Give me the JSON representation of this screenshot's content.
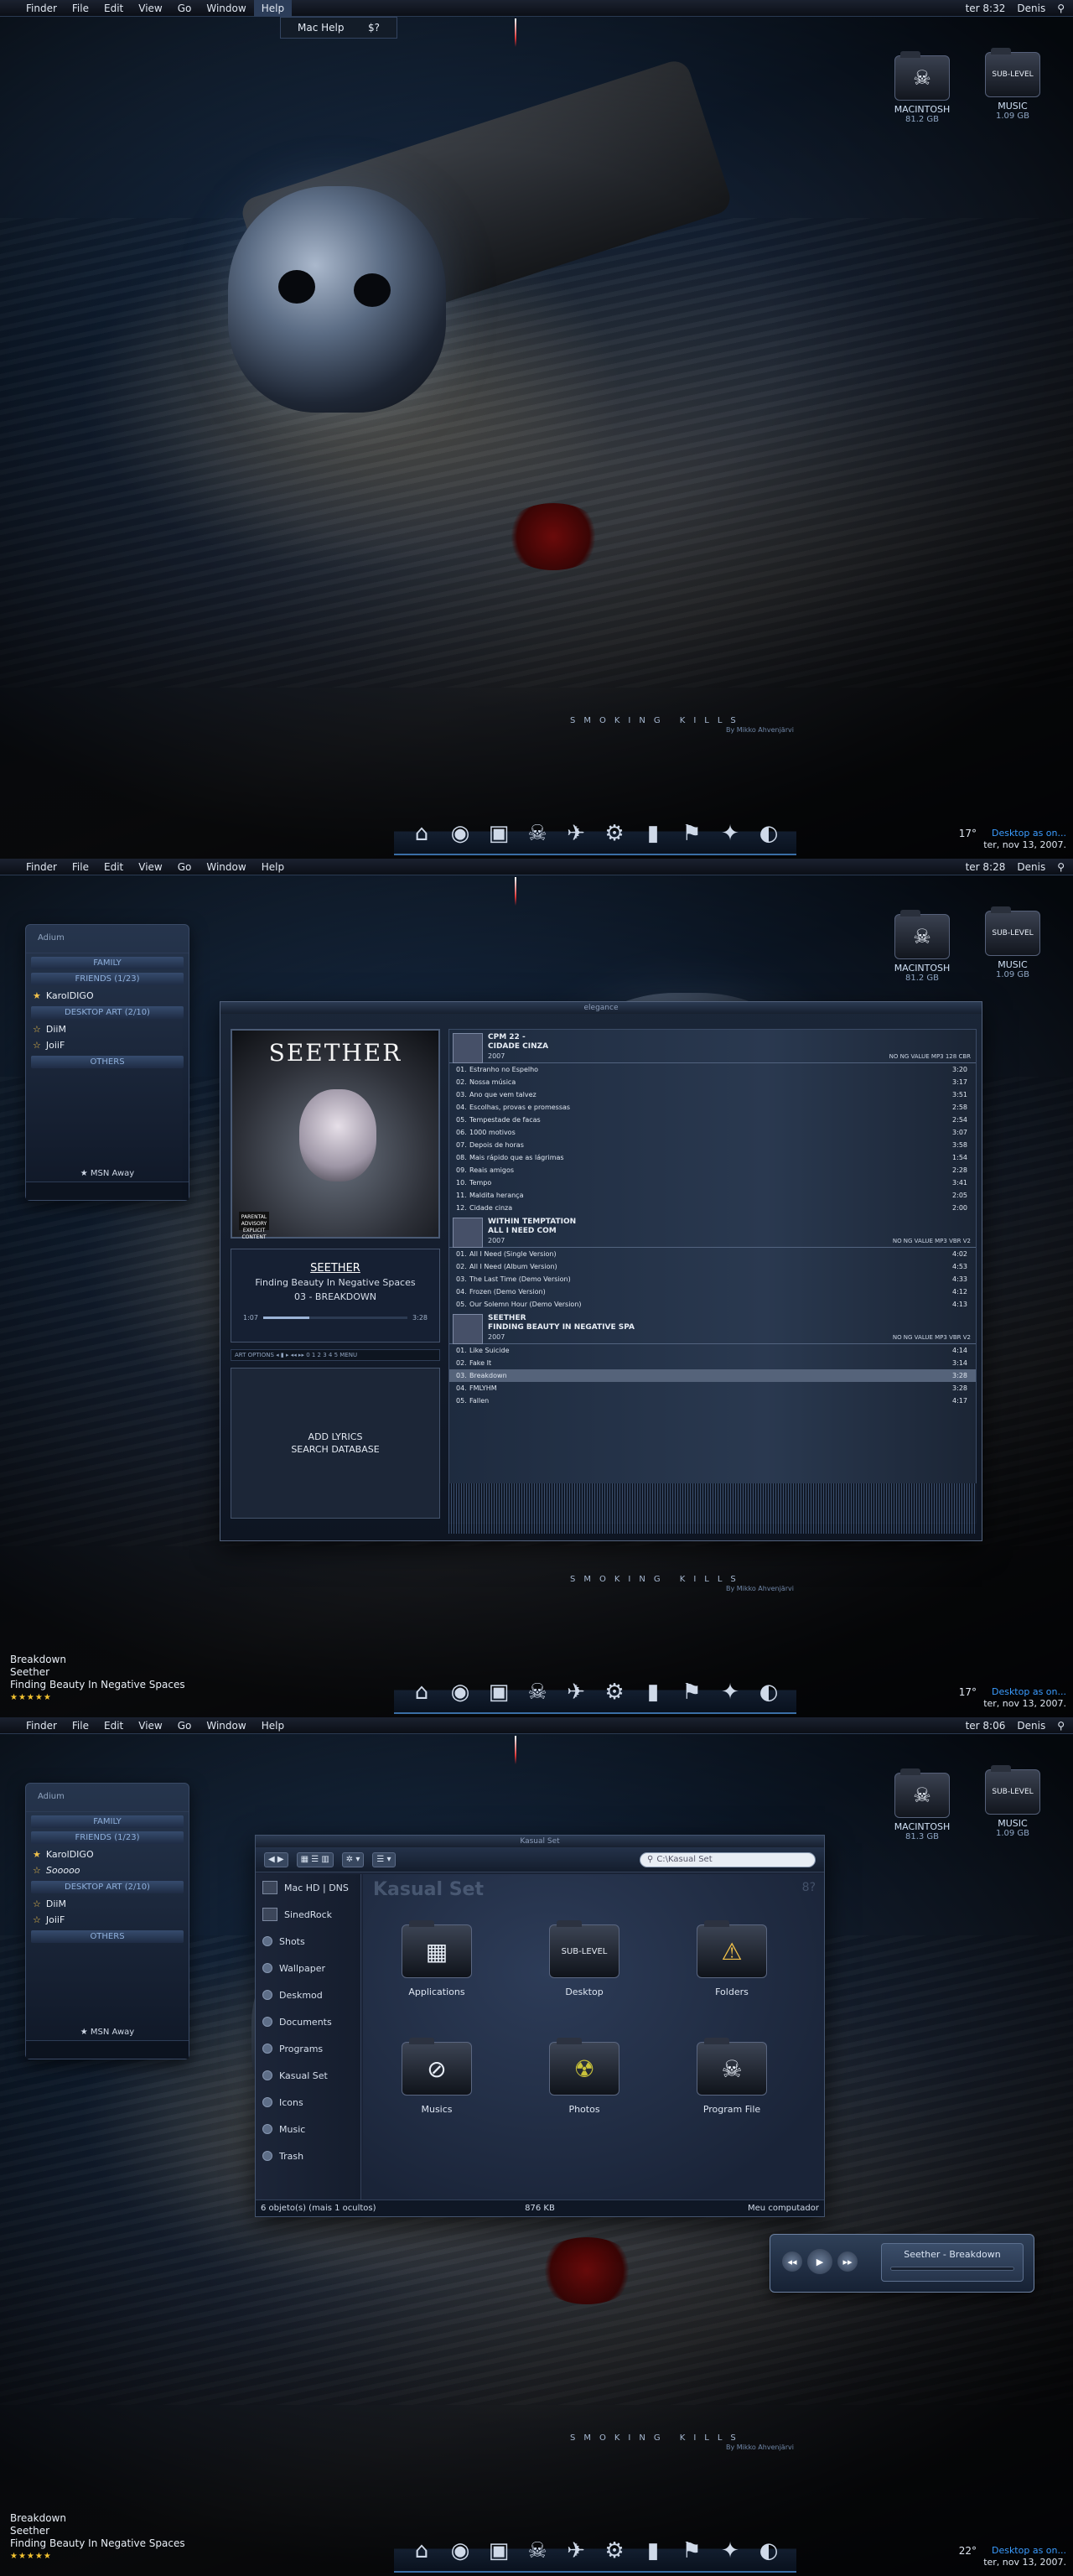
{
  "menubar": {
    "apple": "",
    "items": [
      "Finder",
      "File",
      "Edit",
      "View",
      "Go",
      "Window",
      "Help"
    ],
    "user": "Denis",
    "times": [
      "ter 8:32",
      "ter 8:28",
      "ter 8:06"
    ]
  },
  "help_menu": {
    "label": "Mac Help",
    "shortcut": "$?"
  },
  "drives": [
    {
      "icon": "☠",
      "name": "MACINTOSH",
      "sizes": [
        "81.2 GB",
        "81.2 GB",
        "81.3 GB"
      ]
    },
    {
      "icon": "SUB-LEVEL",
      "name": "MUSIC",
      "sizes": [
        "1.09 GB",
        "1.09 GB",
        "1.09 GB"
      ]
    }
  ],
  "wallpaper": {
    "caption": "SMOKING KILLS",
    "credit": "By Mikko Ahvenjärvi"
  },
  "dock": {
    "icons": [
      "⌂",
      "◉",
      "▣",
      "☠",
      "✈",
      "⚙",
      "▮",
      "⚑",
      "✦",
      "◐"
    ]
  },
  "clock": {
    "temps": [
      "17°",
      "17°",
      "22°"
    ],
    "link": "Desktop as on...",
    "date": "ter, nov 13, 2007."
  },
  "now_playing": {
    "track": "Breakdown",
    "artist": "Seether",
    "album": "Finding Beauty In Negative Spaces",
    "stars": "★★★★★",
    "rating": 5
  },
  "buddy": {
    "title": "Adium",
    "groups": [
      {
        "label": "FAMILY",
        "rows": []
      },
      {
        "label": "FRIENDS (1/23)",
        "rows": [
          {
            "name": "KarolDIGO",
            "star": "★"
          },
          {
            "name": "Sooooo",
            "star": ""
          }
        ]
      },
      {
        "label": "DESKTOP ART (2/10)",
        "rows": [
          {
            "name": "DiiM",
            "star": "☆"
          },
          {
            "name": "JoiiF",
            "star": "☆"
          }
        ]
      },
      {
        "label": "OTHERS",
        "rows": []
      }
    ],
    "status": "★ MSN Away"
  },
  "player": {
    "title": "elegance",
    "art": {
      "band": "SEETHER",
      "advisory": "PARENTAL ADVISORY EXPLICIT CONTENT"
    },
    "info": {
      "band": "SEETHER",
      "album": "Finding Beauty In Negative Spaces",
      "track": "03 - BREAKDOWN",
      "elapsed": "1:07",
      "total": "3:28",
      "progress": 0.32
    },
    "controls": "ART  OPTIONS   ◂ ▮ ▸ ◂◂ ▸▸   0 1 2 3 4 5   MENU",
    "lyrics": [
      "ADD LYRICS",
      "SEARCH DATABASE"
    ],
    "albums": [
      {
        "title": "CPM 22 -",
        "subtitle": "CIDADE CINZA",
        "year": "2007",
        "info": "NO NG VALUE  MP3 128 CBR",
        "tracks": [
          [
            "01.",
            "Estranho no Espelho",
            "3:20"
          ],
          [
            "02.",
            "Nossa música",
            "3:17"
          ],
          [
            "03.",
            "Ano que vem talvez",
            "3:51"
          ],
          [
            "04.",
            "Escolhas, provas e promessas",
            "2:58"
          ],
          [
            "05.",
            "Tempestade de facas",
            "2:54"
          ],
          [
            "06.",
            "1000 motivos",
            "3:07"
          ],
          [
            "07.",
            "Depois de horas",
            "3:58"
          ],
          [
            "08.",
            "Mais rápido que as lágrimas",
            "1:54"
          ],
          [
            "09.",
            "Reais amigos",
            "2:28"
          ],
          [
            "10.",
            "Tempo",
            "3:41"
          ],
          [
            "11.",
            "Maldita herança",
            "2:05"
          ],
          [
            "12.",
            "Cidade cinza",
            "2:00"
          ]
        ]
      },
      {
        "title": "WITHIN TEMPTATION",
        "subtitle": "ALL I NEED COM",
        "year": "2007",
        "info": "NO NG VALUE  MP3 VBR V2",
        "tracks": [
          [
            "01.",
            "All I Need (Single Version)",
            "4:02"
          ],
          [
            "02.",
            "All I Need (Album Version)",
            "4:53"
          ],
          [
            "03.",
            "The Last Time (Demo Version)",
            "4:33"
          ],
          [
            "04.",
            "Frozen (Demo Version)",
            "4:12"
          ],
          [
            "05.",
            "Our Solemn Hour (Demo Version)",
            "4:13"
          ]
        ]
      },
      {
        "title": "SEETHER",
        "subtitle": "FINDING BEAUTY IN NEGATIVE SPA",
        "year": "2007",
        "info": "NO NG VALUE  MP3 VBR V2",
        "tracks": [
          [
            "01.",
            "Like Suicide",
            "4:14"
          ],
          [
            "02.",
            "Fake It",
            "3:14"
          ],
          [
            "03.",
            "Breakdown",
            "3:28"
          ],
          [
            "04.",
            "FMLYHM",
            "3:28"
          ],
          [
            "05.",
            "Fallen",
            "4:17"
          ]
        ]
      }
    ]
  },
  "finder": {
    "title": "Kasual Set",
    "search": "C:\\Kasual Set",
    "heading": "Kasual Set",
    "count": "8?",
    "devices": [
      "Mac HD | DNS",
      "SinedRock"
    ],
    "places": [
      "Shots",
      "Wallpaper",
      "Deskmod",
      "Documents",
      "Programs",
      "Kasual Set",
      "Icons",
      "Music",
      "Trash"
    ],
    "items": [
      {
        "label": "Applications",
        "icon": "▦"
      },
      {
        "label": "Desktop",
        "icon": "SUB-LEVEL"
      },
      {
        "label": "Folders",
        "icon": "⚠"
      },
      {
        "label": "Musics",
        "icon": "⊘"
      },
      {
        "label": "Photos",
        "icon": "☢"
      },
      {
        "label": "Program File",
        "icon": "☠"
      }
    ],
    "status": {
      "objects": "6 objeto(s) (mais 1 ocultos)",
      "size": "876 KB",
      "computer": "Meu computador"
    }
  },
  "miniplayer": {
    "display": "Seether - Breakdown"
  }
}
